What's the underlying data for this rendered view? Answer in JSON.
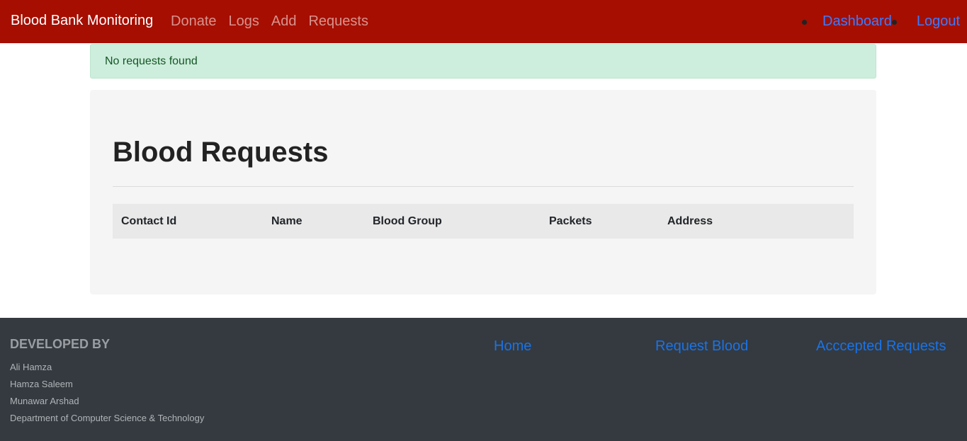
{
  "navbar": {
    "brand": "Blood Bank Monitoring",
    "links": [
      "Donate",
      "Logs",
      "Add",
      "Requests"
    ],
    "right_links": [
      "Dashboard",
      "Logout"
    ]
  },
  "alert": {
    "message": "No requests found"
  },
  "main": {
    "title": "Blood Requests",
    "table": {
      "headers": [
        "Contact Id",
        "Name",
        "Blood Group",
        "Packets",
        "Address"
      ],
      "rows": []
    }
  },
  "footer": {
    "developed_by_title": "DEVELOPED BY",
    "developers": [
      "Ali Hamza",
      "Hamza Saleem",
      "Munawar Arshad"
    ],
    "department": "Department of Computer Science & Technology",
    "links": [
      "Home",
      "Request Blood",
      "Acccepted Requests"
    ]
  }
}
